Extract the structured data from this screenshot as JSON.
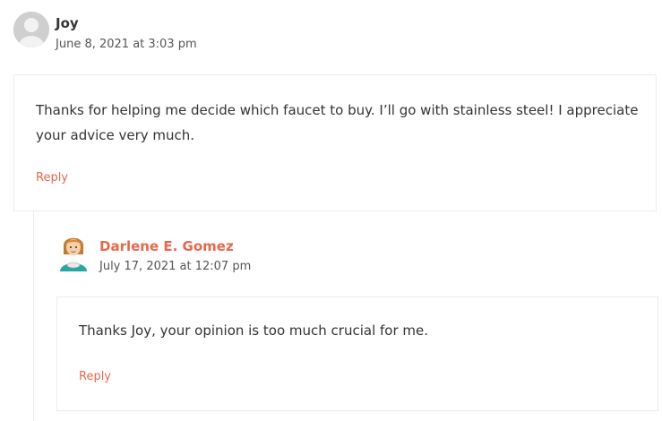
{
  "comments": [
    {
      "author": "Joy",
      "date": "June 8, 2021 at 3:03 pm",
      "text": "Thanks for helping me decide which faucet to buy. I’ll go with stainless steel! I appreciate your advice very much.",
      "reply_label": "Reply",
      "avatar": "default-user-icon"
    },
    {
      "author": "Darlene E. Gomez",
      "date": "July 17, 2021 at 12:07 pm",
      "text": "Thanks Joy, your opinion is too much crucial for me.",
      "reply_label": "Reply",
      "avatar": "cartoon-woman-avatar"
    }
  ],
  "colors": {
    "accent": "#e8674c",
    "border": "#ececec",
    "text": "#333333",
    "meta": "#555555"
  }
}
